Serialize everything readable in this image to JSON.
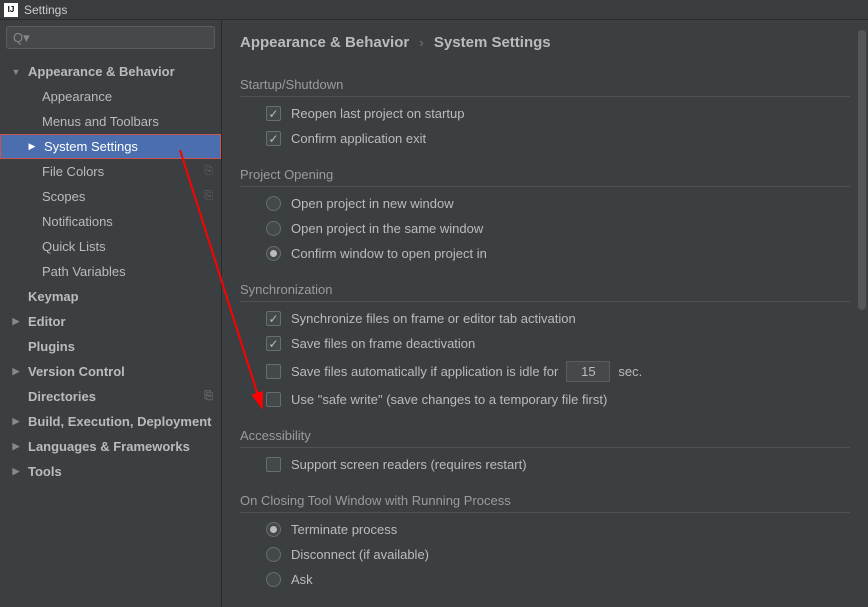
{
  "window": {
    "title": "Settings"
  },
  "search": {
    "placeholder": ""
  },
  "breadcrumb": {
    "parent": "Appearance & Behavior",
    "current": "System Settings"
  },
  "sidebar": {
    "appearance_behavior": "Appearance & Behavior",
    "appearance": "Appearance",
    "menus_toolbars": "Menus and Toolbars",
    "system_settings": "System Settings",
    "file_colors": "File Colors",
    "scopes": "Scopes",
    "notifications": "Notifications",
    "quick_lists": "Quick Lists",
    "path_variables": "Path Variables",
    "keymap": "Keymap",
    "editor": "Editor",
    "plugins": "Plugins",
    "version_control": "Version Control",
    "directories": "Directories",
    "build": "Build, Execution, Deployment",
    "languages": "Languages & Frameworks",
    "tools": "Tools"
  },
  "sections": {
    "startup": {
      "title": "Startup/Shutdown",
      "reopen": "Reopen last project on startup",
      "confirm_exit": "Confirm application exit"
    },
    "project_opening": {
      "title": "Project Opening",
      "new_window": "Open project in new window",
      "same_window": "Open project in the same window",
      "confirm": "Confirm window to open project in"
    },
    "sync": {
      "title": "Synchronization",
      "sync_files": "Synchronize files on frame or editor tab activation",
      "save_deactivation": "Save files on frame deactivation",
      "save_auto_prefix": "Save files automatically if application is idle for",
      "save_auto_value": "15",
      "save_auto_suffix": "sec.",
      "safe_write": "Use \"safe write\" (save changes to a temporary file first)"
    },
    "accessibility": {
      "title": "Accessibility",
      "screen_readers": "Support screen readers (requires restart)"
    },
    "closing": {
      "title": "On Closing Tool Window with Running Process",
      "terminate": "Terminate process",
      "disconnect": "Disconnect (if available)",
      "ask": "Ask"
    }
  }
}
